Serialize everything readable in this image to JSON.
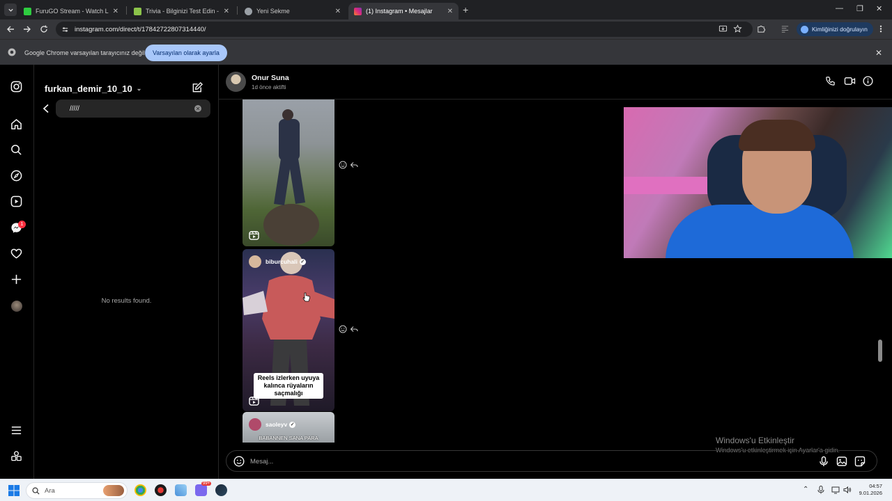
{
  "browser": {
    "tabs": [
      {
        "title": "FuruGO Stream - Watch Live or",
        "favicon_color": "#2ecc40",
        "active": false
      },
      {
        "title": "Trivia - Bilginizi Test Edin - Quiz",
        "favicon_color": "#8bc34a",
        "active": false
      },
      {
        "title": "Yeni Sekme",
        "favicon_color": "#9aa0a6",
        "active": false
      },
      {
        "title": "(1) Instagram • Mesajlar",
        "favicon_color": "#e1306c",
        "active": true
      }
    ],
    "url": "instagram.com/direct/t/17842722807314440/",
    "verify_label": "Kimliğinizi doğrulayın",
    "infobar": {
      "message": "Google Chrome varsayılan tarayıcınız değil",
      "button": "Varsayılan olarak ayarla"
    }
  },
  "instagram": {
    "rail_icons": [
      "instagram-logo",
      "home",
      "search",
      "explore",
      "reels",
      "messenger",
      "notifications-heart",
      "create",
      "profile",
      "menu",
      "also-from-meta"
    ],
    "notification_count": "1",
    "inbox": {
      "username": "furkan_demir_10_10",
      "search_value": "/////",
      "no_results": "No results found."
    },
    "thread": {
      "contact_name": "Onur Suna",
      "contact_status": "1d önce aktifti",
      "reels": [
        {
          "user": "",
          "caption": ""
        },
        {
          "user": "biburcuhali",
          "caption": "Reels izlerken uyuya kalınca rüyaların saçmalığı"
        },
        {
          "user": "saoleyv",
          "caption": "BABANNEN SANA PARA"
        }
      ],
      "composer_placeholder": "Mesaj..."
    }
  },
  "windows": {
    "activation_title": "Windows'u Etkinleştir",
    "activation_sub": "Windows'u etkinleştirmek için Ayarlar'a gidin.",
    "taskbar_search": "Ara",
    "time": "04:57",
    "date": "9.01.2026",
    "discord_badge": "99+"
  }
}
